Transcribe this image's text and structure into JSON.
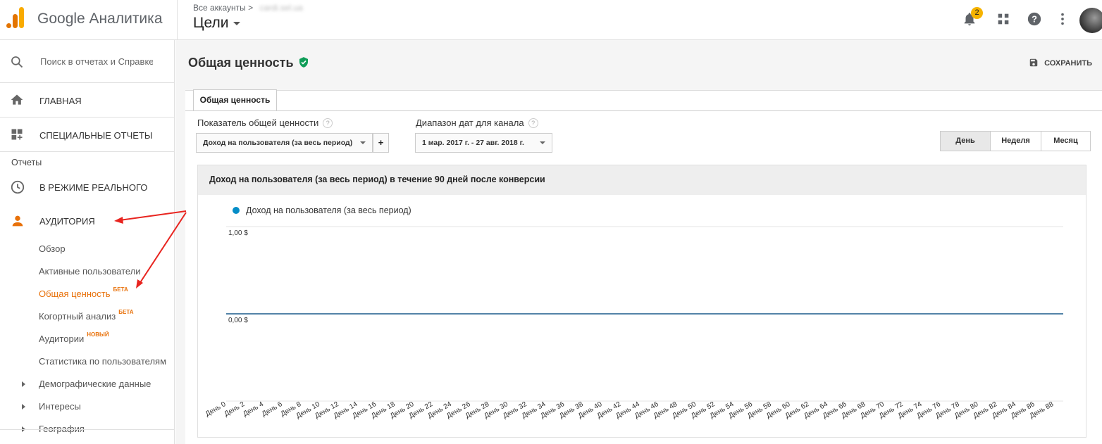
{
  "header": {
    "brand": "Google Аналитика",
    "breadcrumb_label": "Все аккаунты",
    "breadcrumb_sep": ">",
    "breadcrumb_account": "cardi.sel.ua",
    "view_title": "Цели",
    "notifications_count": "2"
  },
  "sidebar": {
    "search_placeholder": "Поиск в отчетах и Справке",
    "nav": [
      {
        "label": "Главная",
        "icon": "home-icon"
      },
      {
        "label": "Специальные отчеты",
        "icon": "custom-reports-icon"
      }
    ],
    "section_title": "Отчеты",
    "realtime_label": "В режиме реального",
    "audience_label": "Аудитория",
    "audience_items": [
      {
        "label": "Обзор",
        "tag": ""
      },
      {
        "label": "Активные пользователи",
        "tag": ""
      },
      {
        "label": "Общая ценность",
        "tag": "БЕТА",
        "active": true
      },
      {
        "label": "Когортный анализ",
        "tag": "БЕТА"
      },
      {
        "label": "Аудитории",
        "tag": "НОВЫЙ"
      },
      {
        "label": "Статистика по пользователям",
        "tag": ""
      },
      {
        "label": "Демографические данные",
        "tag": "",
        "expandable": true
      },
      {
        "label": "Интересы",
        "tag": "",
        "expandable": true
      },
      {
        "label": "География",
        "tag": "",
        "expandable": true
      }
    ]
  },
  "main": {
    "page_title": "Общая ценность",
    "save_label": "СОХРАНИТЬ",
    "tab_label": "Общая ценность",
    "metric_label": "Показатель общей ценности",
    "metric_value": "Доход на пользователя (за весь период)",
    "plus_label": "+",
    "date_label": "Диапазон дат для канала",
    "date_value": "1 мар. 2017 г. - 27 авг. 2018 г.",
    "granularity": [
      "День",
      "Неделя",
      "Месяц"
    ],
    "granularity_selected": "День",
    "help_glyph": "?"
  },
  "chart_data": {
    "type": "line",
    "title": "Доход на пользователя (за весь период) в течение 90 дней после конверсии",
    "series": [
      {
        "name": "Доход на пользователя (за весь период)",
        "color": "#058dc7",
        "values": [
          0,
          0,
          0,
          0,
          0,
          0,
          0,
          0,
          0,
          0,
          0,
          0,
          0,
          0,
          0,
          0,
          0,
          0,
          0,
          0,
          0,
          0,
          0,
          0,
          0,
          0,
          0,
          0,
          0,
          0,
          0,
          0,
          0,
          0,
          0,
          0,
          0,
          0,
          0,
          0,
          0,
          0,
          0,
          0,
          0,
          0,
          0,
          0,
          0,
          0,
          0,
          0,
          0,
          0,
          0,
          0,
          0,
          0,
          0,
          0,
          0,
          0,
          0,
          0,
          0,
          0,
          0,
          0,
          0,
          0,
          0,
          0,
          0,
          0,
          0,
          0,
          0,
          0,
          0,
          0,
          0,
          0,
          0,
          0,
          0,
          0,
          0,
          0,
          0,
          0
        ]
      }
    ],
    "y_ticks": [
      "1,00 $",
      "0,00 $"
    ],
    "ylim": [
      0,
      1
    ],
    "x_ticks": [
      "День 0",
      "День 2",
      "День 4",
      "День 6",
      "День 8",
      "День 10",
      "День 12",
      "День 14",
      "День 16",
      "День 18",
      "День 20",
      "День 22",
      "День 24",
      "День 26",
      "День 28",
      "День 30",
      "День 32",
      "День 34",
      "День 36",
      "День 38",
      "День 40",
      "День 42",
      "День 44",
      "День 46",
      "День 48",
      "День 50",
      "День 52",
      "День 54",
      "День 56",
      "День 58",
      "День 60",
      "День 62",
      "День 64",
      "День 66",
      "День 68",
      "День 70",
      "День 72",
      "День 74",
      "День 76",
      "День 78",
      "День 80",
      "День 82",
      "День 84",
      "День 86",
      "День 88"
    ]
  },
  "colors": {
    "accent_orange": "#e8710a",
    "series_blue": "#058dc7",
    "verified_green": "#0f9d58",
    "annotation_red": "#e8241f",
    "badge_yellow": "#f6b300"
  }
}
